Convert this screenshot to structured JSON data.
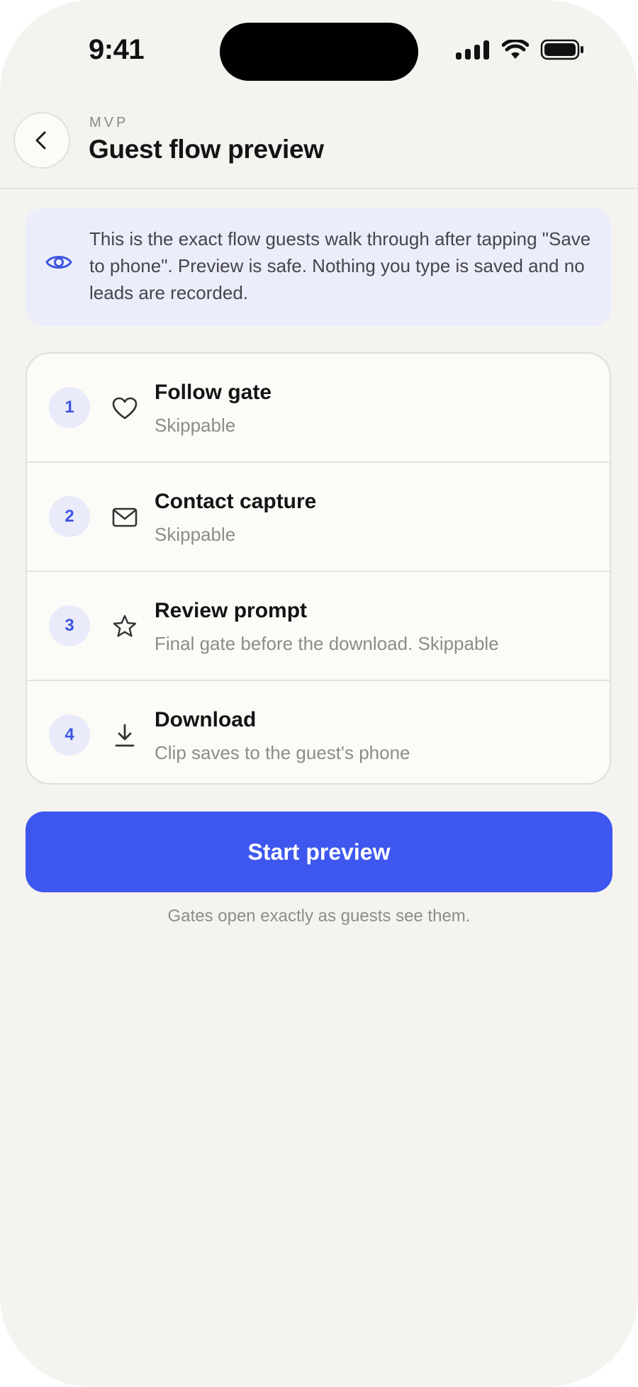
{
  "status_bar": {
    "time": "9:41"
  },
  "header": {
    "eyebrow": "MVP",
    "title": "Guest flow preview",
    "back_icon": "chevron-left-icon"
  },
  "info_banner": {
    "icon": "eye-icon",
    "text": "This is the exact flow guests walk through after tapping \"Save to phone\". Preview is safe. Nothing you type is saved and no leads are recorded."
  },
  "steps": [
    {
      "number": "1",
      "icon": "heart-icon",
      "title": "Follow gate",
      "subtitle": "Skippable"
    },
    {
      "number": "2",
      "icon": "mail-icon",
      "title": "Contact capture",
      "subtitle": "Skippable"
    },
    {
      "number": "3",
      "icon": "star-icon",
      "title": "Review prompt",
      "subtitle": "Final gate before the download. Skippable"
    },
    {
      "number": "4",
      "icon": "download-icon",
      "title": "Download",
      "subtitle": "Clip saves to the guest's phone"
    }
  ],
  "primary_button": {
    "label": "Start preview"
  },
  "footnote": "Gates open exactly as guests see them.",
  "colors": {
    "accent": "#3E57EE",
    "background": "#F4F3F0",
    "banner": "#EBEDFB",
    "card": "#FCFBF8"
  }
}
